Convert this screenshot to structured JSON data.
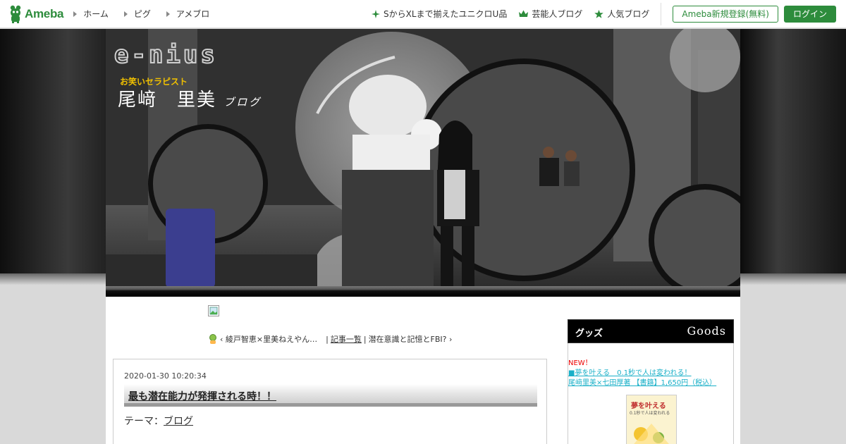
{
  "topbar": {
    "logo_text": "Ameba",
    "nav": [
      "ホーム",
      "ピグ",
      "アメブロ"
    ],
    "right_links": [
      {
        "label": "SからXLまで揃えたユニクロU品",
        "icon": "sparkle-icon"
      },
      {
        "label": "芸能人ブログ",
        "icon": "crown-icon"
      },
      {
        "label": "人気ブログ",
        "icon": "star-icon"
      }
    ],
    "register_label": "Ameba新規登録(無料)",
    "login_label": "ログイン",
    "brand_color": "#2d8c3c"
  },
  "header": {
    "brand_word": "e-nius",
    "subtitle": "お笑いセラピスト",
    "blog_name": "尾﨑　里美",
    "blog_suffix": "ブログ"
  },
  "pager": {
    "prev": "綾戸智恵×里美ねえやん…",
    "list": "記事一覧",
    "next": "潜在意識と記憶とFBI?"
  },
  "article": {
    "date": "2020-01-30 10:20:34",
    "title": "最も潜在能力が発揮される時！！",
    "theme_label": "テーマ：",
    "theme": "ブログ"
  },
  "sidebar": {
    "goods_jp": "グッズ",
    "goods_en": "Goods",
    "new_label": "NEW！",
    "line1": "■夢を叶える　0.1秒で人は変われる！",
    "line2": "尾﨑里美×七田厚著 【書籍】1,650円（税込）",
    "book_title": "夢を叶える",
    "book_sub": "0.1秒で人は変われる"
  }
}
